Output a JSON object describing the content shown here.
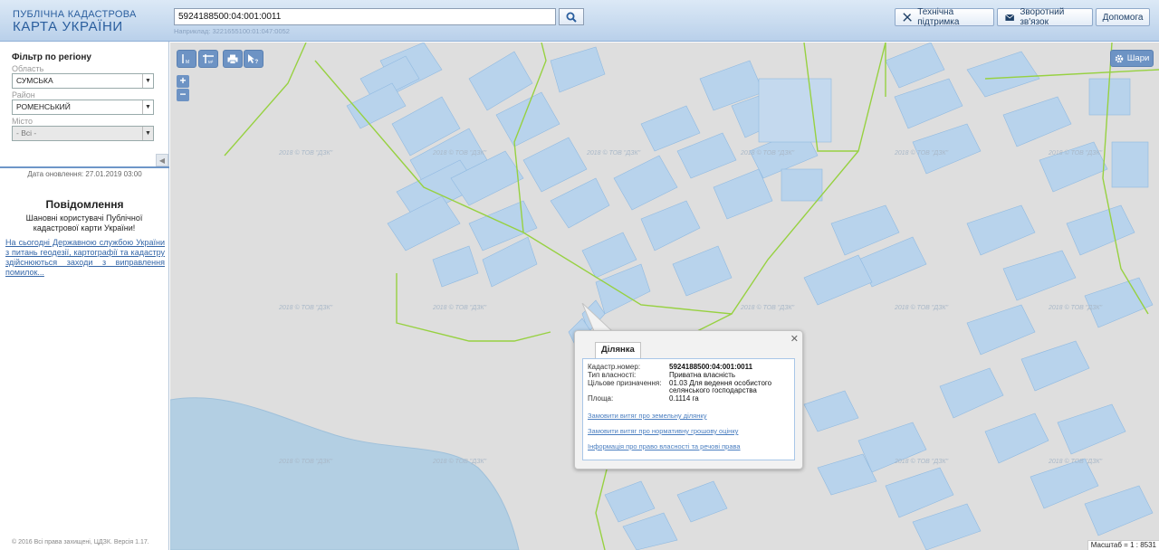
{
  "header": {
    "logo_line1": "ПУБЛІЧНА КАДАСТРОВА",
    "logo_line2": "КАРТА УКРАЇНИ",
    "search_value": "5924188500:04:001:0011",
    "search_example": "Наприклад: 3221655100:01:047:0052",
    "support_label": "Технічна підтримка",
    "feedback_label": "Зворотний зв'язок",
    "help_label": "Допомога"
  },
  "sidebar": {
    "filter_title": "Фільтр по регіону",
    "region_label": "Область",
    "region_value": "СУМСЬКА",
    "district_label": "Район",
    "district_value": "РОМЕНСЬКИЙ",
    "city_label": "Місто",
    "city_value": "- Всі -",
    "update_date": "Дата оновлення: 27.01.2019 03:00",
    "notice_title": "Повідомлення",
    "notice_text": "Шановні користувачі Публічної кадастрової карти України!",
    "notice_link": "На сьогодні Державною службою України з питань геодезії, картографії та кадастру здійснюються заходи з виправлення помилок...",
    "copyright": "© 2016 Всі права захищені, ЦДЗК. Версія 1.17."
  },
  "map": {
    "layers_label": "Шари",
    "watermark": "2018 © ТОВ \"ДЗК\"",
    "scale_text": "Масштаб = 1 : 8531"
  },
  "popup": {
    "tab_label": "Ділянка",
    "rows": [
      {
        "key": "Кадастр.номер:",
        "value": "5924188500:04:001:0011"
      },
      {
        "key": "Тип власності:",
        "value": "Приватна власність"
      },
      {
        "key": "Цільове призначення:",
        "value": "01.03 Для ведення особистого селянського господарства"
      },
      {
        "key": "Площа:",
        "value": "0.1114 га"
      }
    ],
    "links": [
      "Замовити витяг про земельну ділянку",
      "Замовити витяг про нормативну грошову оцінку",
      "Інформація про право власності та речові права"
    ]
  }
}
